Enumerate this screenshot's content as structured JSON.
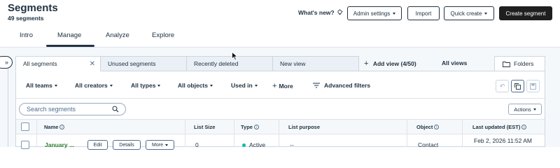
{
  "header": {
    "title": "Segments",
    "subtitle": "49 segments",
    "whats_new": "What's new?",
    "buttons": {
      "admin_settings": "Admin settings",
      "import": "Import",
      "quick_create": "Quick create",
      "create_segment": "Create segment"
    }
  },
  "tabs": [
    "Intro",
    "Manage",
    "Analyze",
    "Explore"
  ],
  "active_tab": "Manage",
  "view_tabs": [
    "All segments",
    "Unused segments",
    "Recently deleted",
    "New view"
  ],
  "add_view": "Add view (4/50)",
  "all_views": "All views",
  "folders": "Folders",
  "filters": {
    "all_teams": "All teams",
    "all_creators": "All creators",
    "all_types": "All types",
    "all_objects": "All objects",
    "used_in": "Used in",
    "more": "More",
    "advanced": "Advanced filters"
  },
  "search": {
    "placeholder": "Search segments"
  },
  "actions": "Actions",
  "table": {
    "columns": [
      "Name",
      "List Size",
      "Type",
      "List purpose",
      "Object",
      "Last updated (EST)"
    ],
    "rows": [
      {
        "name": "January ...",
        "edit": "Edit",
        "details": "Details",
        "more": "More",
        "list_size": "0",
        "type": "Active",
        "purpose": "--",
        "object": "Contact",
        "updated": "Feb 2, 2026 11:52 AM"
      }
    ]
  },
  "colors": {
    "text": "#213343",
    "border": "#cbd6e2",
    "dark_button": "#1f1f1f",
    "link_green": "#00a4bd",
    "active_dot": "#00bda5",
    "name_link": "#2e7d32"
  }
}
